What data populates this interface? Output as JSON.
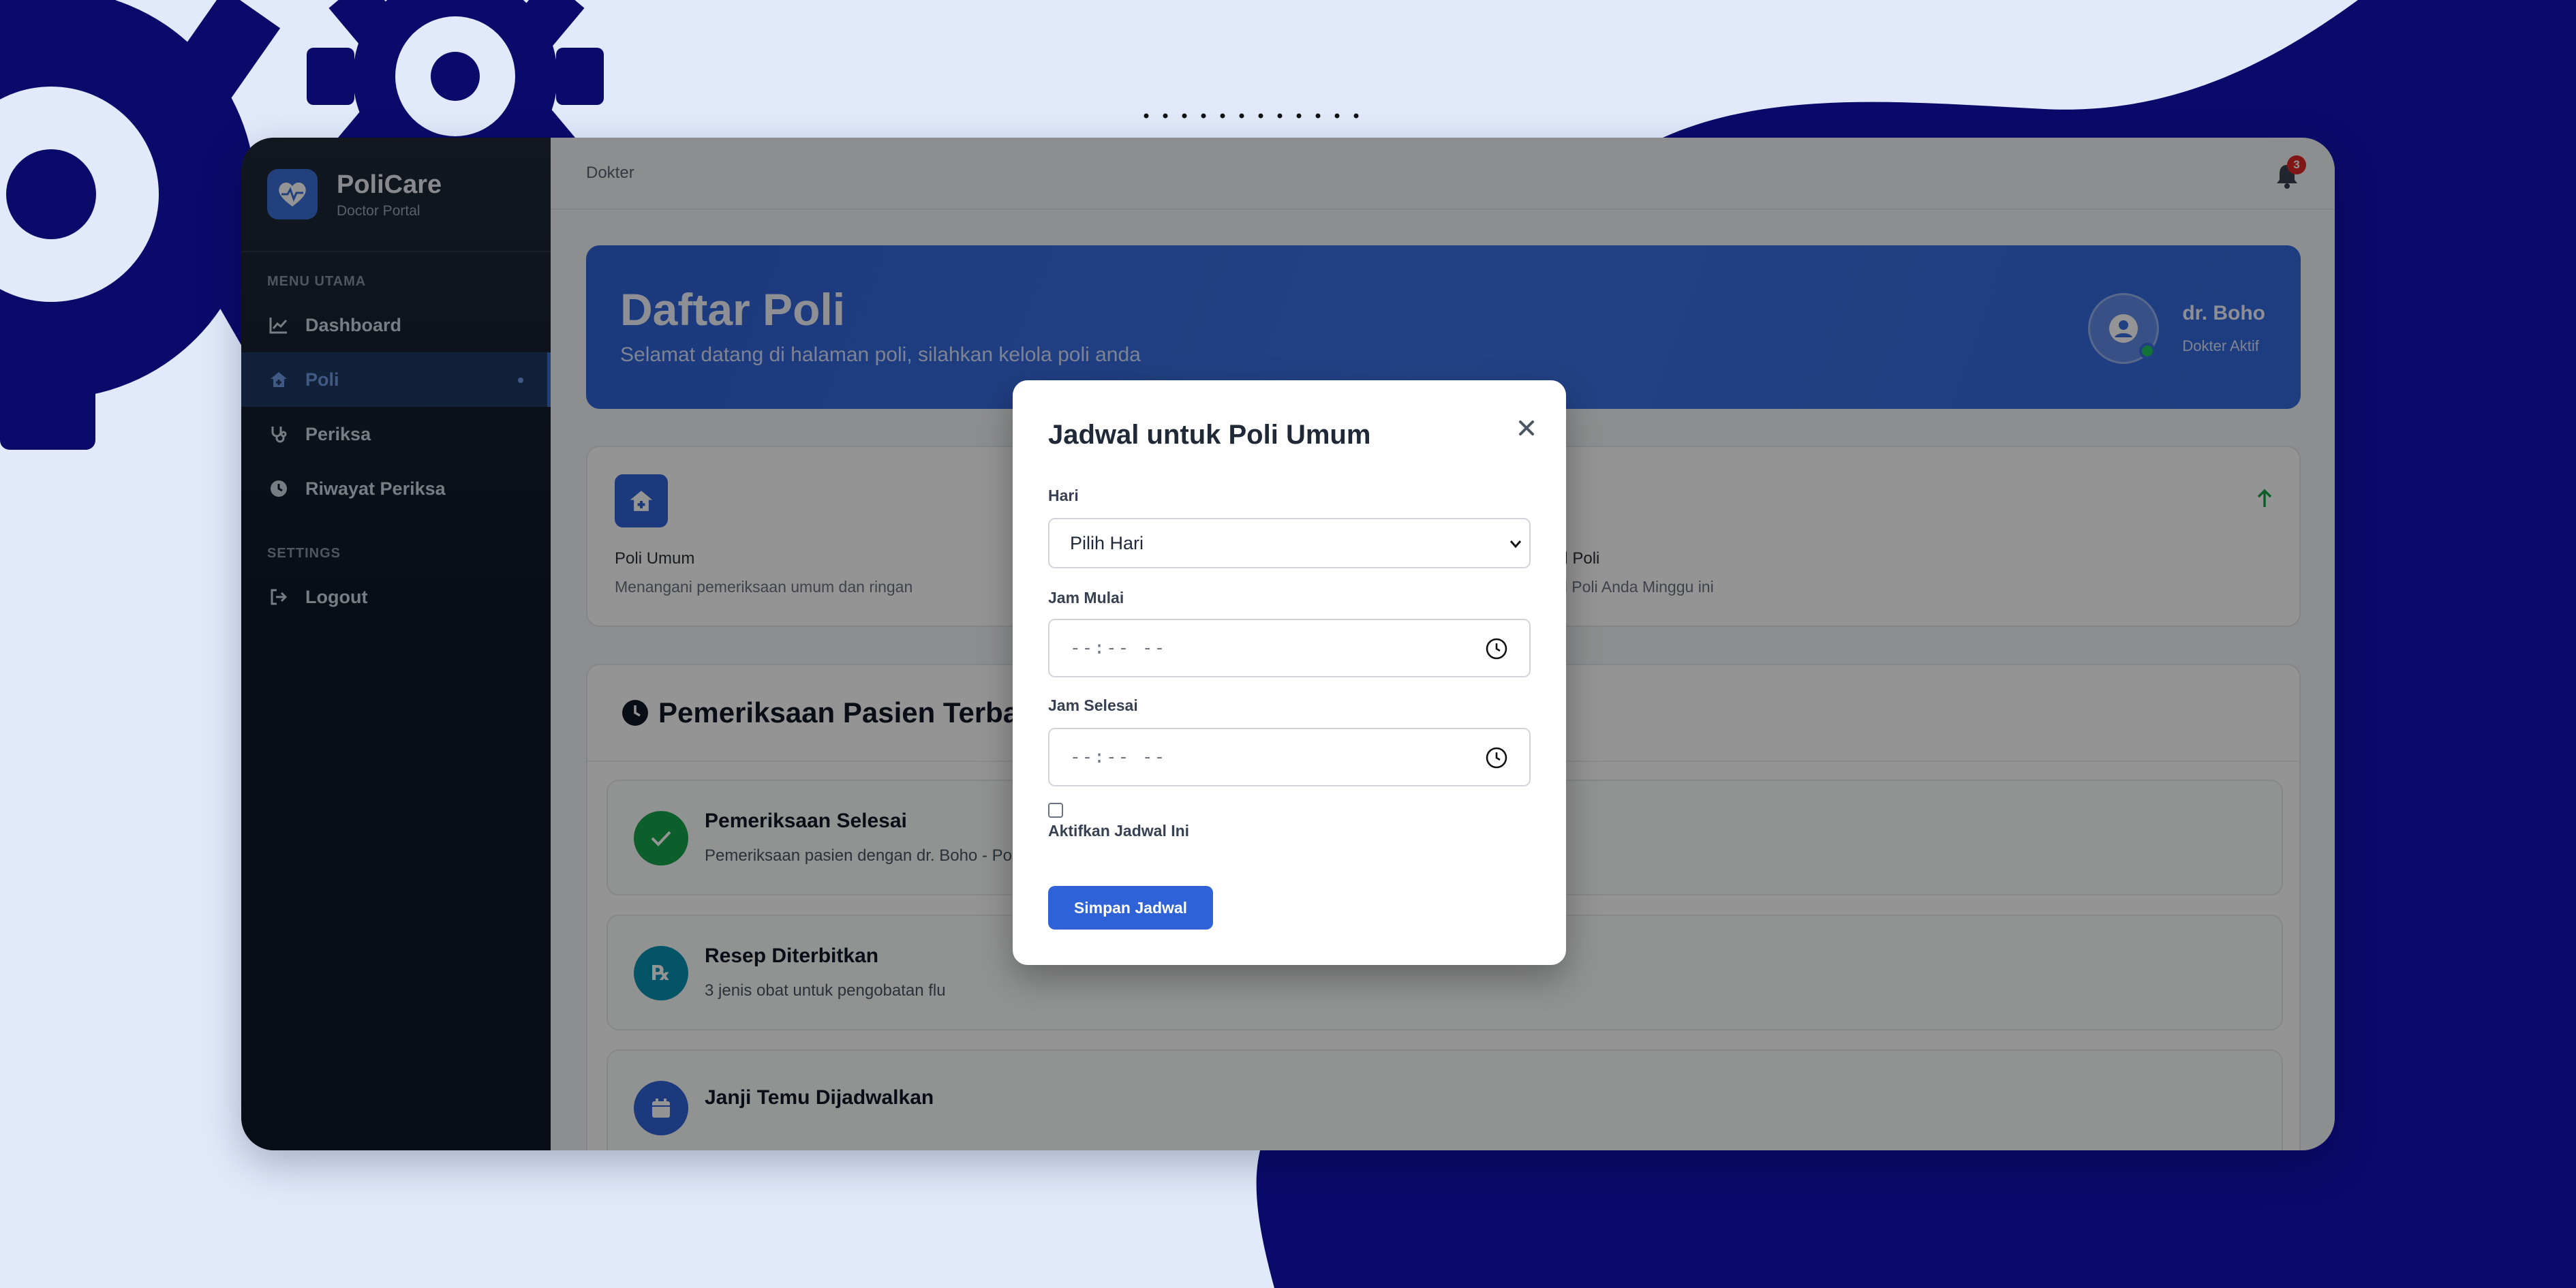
{
  "sidebar": {
    "brand_name": "PoliCare",
    "brand_sub": "Doctor Portal",
    "section_main": "MENU UTAMA",
    "section_settings": "SETTINGS",
    "items": [
      {
        "label": "Dashboard",
        "icon": "chart-line-icon"
      },
      {
        "label": "Poli",
        "icon": "clinic-icon",
        "active": true
      },
      {
        "label": "Periksa",
        "icon": "stethoscope-icon"
      },
      {
        "label": "Riwayat Periksa",
        "icon": "history-icon"
      }
    ],
    "logout_label": "Logout"
  },
  "topbar": {
    "breadcrumb": "Dokter",
    "notification_count": "3"
  },
  "hero": {
    "title": "Daftar Poli",
    "subtitle": "Selamat datang di halaman poli, silahkan kelola poli anda",
    "user_name": "dr. Boho",
    "user_role": "Dokter Aktif"
  },
  "info_card": {
    "poli_name": "Poli Umum",
    "poli_desc": "Menangani pemeriksaan umum dan ringan",
    "card2_title_visible": "al Poli",
    "card2_desc_visible": "al Poli Anda Minggu ini"
  },
  "activity": {
    "title": "Pemeriksaan Pasien Terbaru",
    "items": [
      {
        "title": "Pemeriksaan Selesai",
        "desc": "Pemeriksaan pasien dengan dr. Boho - Pol",
        "color": "#16a34a"
      },
      {
        "title": "Resep Diterbitkan",
        "desc": "3 jenis obat untuk pengobatan flu",
        "color": "#0891b2"
      },
      {
        "title": "Janji Temu Dijadwalkan",
        "desc": "",
        "color": "#2f62d6"
      }
    ]
  },
  "modal": {
    "title": "Jadwal untuk Poli Umum",
    "day_label": "Hari",
    "day_value": "Pilih Hari",
    "start_label": "Jam Mulai",
    "start_value": "--:-- --",
    "end_label": "Jam Selesai",
    "end_value": "--:-- --",
    "active_label": "Aktifkan Jadwal Ini",
    "save_label": "Simpan Jadwal"
  },
  "colors": {
    "accent": "#2f62d6",
    "background": "#e1e9fb",
    "decor_navy": "#0a0a6b"
  }
}
